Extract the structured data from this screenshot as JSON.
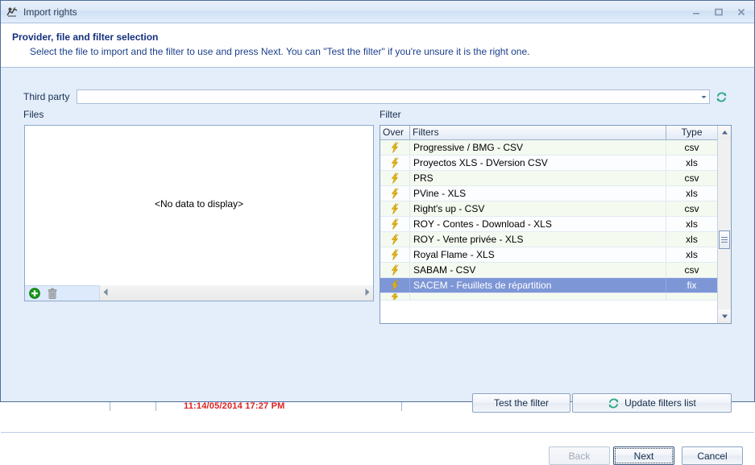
{
  "window": {
    "title": "Import rights",
    "icon": "import-rights-icon",
    "controls": {
      "minimize": "minimize-icon",
      "maximize": "maximize-icon",
      "close": "close-icon"
    }
  },
  "header": {
    "title": "Provider, file and filter selection",
    "subtitle": "Select the file to import and the filter to use and press Next. You can \"Test the filter\" if you're unsure it is the right one."
  },
  "third_party": {
    "label": "Third party",
    "value": "",
    "placeholder": "",
    "dropdown_icon": "chevron-down-icon",
    "refresh_icon": "refresh-icon"
  },
  "files": {
    "label": "Files",
    "empty_text": "<No data to display>",
    "add_icon": "add-icon",
    "delete_icon": "trash-icon",
    "scroll_left_icon": "triangle-left-icon",
    "scroll_right_icon": "triangle-right-icon"
  },
  "filter": {
    "label": "Filter",
    "columns": [
      "Over",
      "Filters",
      "Type"
    ],
    "row_icon": "lightning-icon",
    "rows": [
      {
        "name": "Progressive / BMG - CSV",
        "type": "csv",
        "selected": false
      },
      {
        "name": "Proyectos XLS - DVersion CSV",
        "type": "xls",
        "selected": false
      },
      {
        "name": "PRS",
        "type": "csv",
        "selected": false
      },
      {
        "name": "PVine - XLS",
        "type": "xls",
        "selected": false
      },
      {
        "name": "Right's up - CSV",
        "type": "csv",
        "selected": false
      },
      {
        "name": "ROY - Contes - Download - XLS",
        "type": "xls",
        "selected": false
      },
      {
        "name": "ROY - Vente privée - XLS",
        "type": "xls",
        "selected": false
      },
      {
        "name": "Royal Flame - XLS",
        "type": "xls",
        "selected": false
      },
      {
        "name": "SABAM - CSV",
        "type": "csv",
        "selected": false
      },
      {
        "name": "SACEM - Feuillets de répartition",
        "type": "fix",
        "selected": true
      },
      {
        "name": "",
        "type": "",
        "selected": false
      }
    ],
    "scroll_up_icon": "triangle-up-icon",
    "scroll_down_icon": "triangle-down-icon"
  },
  "actions": {
    "test_filter": "Test the filter",
    "update_filters": "Update filters list",
    "update_filters_icon": "refresh-icon"
  },
  "footer": {
    "back": "Back",
    "next": "Next",
    "cancel": "Cancel"
  },
  "backdrop": {
    "red_text": "11:14/05/2014 17:27 PM"
  },
  "colors": {
    "accent_blue": "#15317e",
    "selection": "#7d96d6",
    "chrome": "#e4edfa",
    "refresh_green": "#2fa884",
    "add_green": "#2aa82a",
    "lightning_yellow": "#f5c518"
  }
}
